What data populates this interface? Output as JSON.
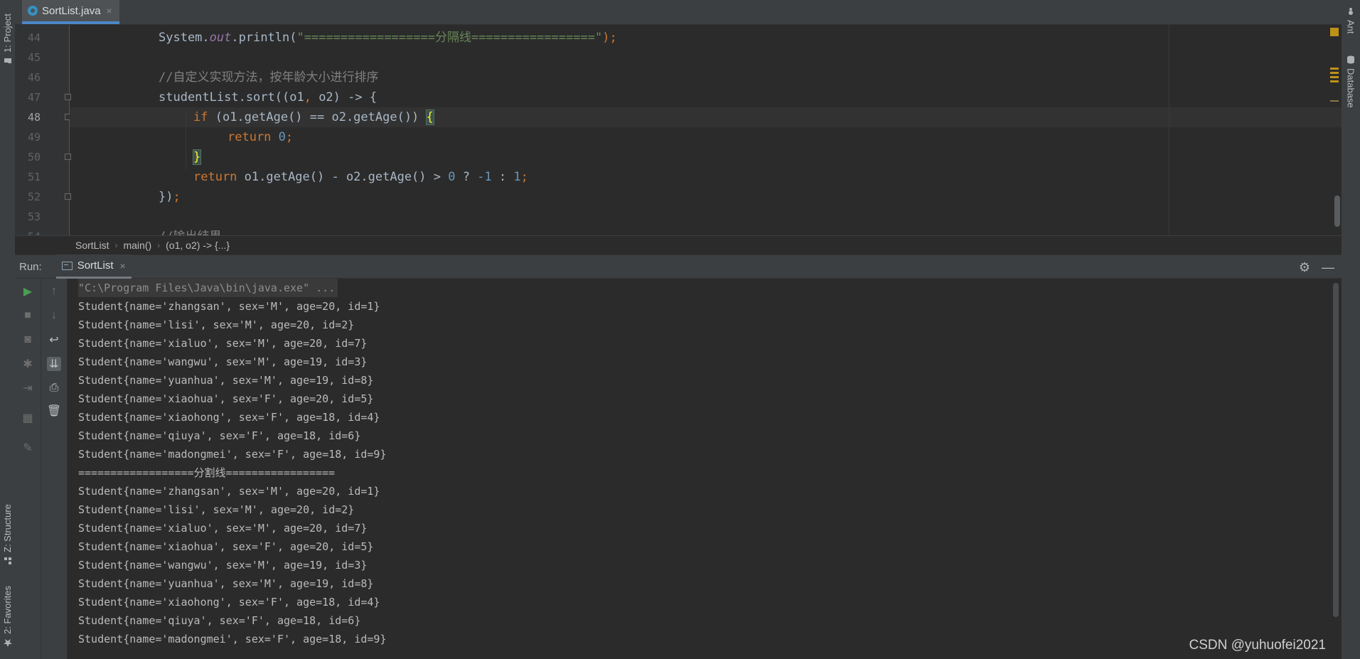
{
  "side_tabs": {
    "project": "1: Project",
    "structure": "Z: Structure",
    "favorites": "2: Favorites",
    "ant": "Ant",
    "database": "Database"
  },
  "editor": {
    "file_tab": "SortList.java",
    "tab_close": "×",
    "line_numbers": [
      "44",
      "45",
      "46",
      "47",
      "48",
      "49",
      "50",
      "51",
      "52",
      "53",
      "54"
    ],
    "lines": {
      "l44": {
        "a": "System.",
        "b": "out",
        "c": ".println(",
        "d": "\"==================分隔线=================\"",
        "e": ");"
      },
      "l46": {
        "a": "//自定义实现方法，按年龄大小进行排序"
      },
      "l47": {
        "a": "studentList.sort((o1",
        "b": ",",
        "c": " o2) -> {"
      },
      "l48": {
        "a": "if",
        "b": " (o1.getAge() == o2.getAge()) ",
        "c": "{"
      },
      "l49": {
        "a": "return",
        "b": " ",
        "c": "0",
        "d": ";"
      },
      "l50": {
        "a": "}"
      },
      "l51": {
        "a": "return",
        "b": " o1.getAge() - o2.getAge() > ",
        "c": "0",
        "d": " ? ",
        "e": "-1",
        "f": " : ",
        "g": "1",
        "h": ";"
      },
      "l52": {
        "a": "})",
        "b": ";"
      },
      "l54": {
        "a": "//输出结果"
      }
    }
  },
  "breadcrumb": [
    "SortList",
    "main()",
    "(o1, o2) -> {...}"
  ],
  "breadcrumb_sep": "›",
  "run": {
    "label": "Run:",
    "tab": "SortList",
    "tab_close": "×"
  },
  "console": {
    "lines": [
      "\"C:\\Program Files\\Java\\bin\\java.exe\" ...",
      "Student{name='zhangsan', sex='M', age=20, id=1}",
      "Student{name='lisi', sex='M', age=20, id=2}",
      "Student{name='xialuo', sex='M', age=20, id=7}",
      "Student{name='wangwu', sex='M', age=19, id=3}",
      "Student{name='yuanhua', sex='M', age=19, id=8}",
      "Student{name='xiaohua', sex='F', age=20, id=5}",
      "Student{name='xiaohong', sex='F', age=18, id=4}",
      "Student{name='qiuya', sex='F', age=18, id=6}",
      "Student{name='madongmei', sex='F', age=18, id=9}",
      "==================分割线=================",
      "Student{name='zhangsan', sex='M', age=20, id=1}",
      "Student{name='lisi', sex='M', age=20, id=2}",
      "Student{name='xialuo', sex='M', age=20, id=7}",
      "Student{name='xiaohua', sex='F', age=20, id=5}",
      "Student{name='wangwu', sex='M', age=19, id=3}",
      "Student{name='yuanhua', sex='M', age=19, id=8}",
      "Student{name='xiaohong', sex='F', age=18, id=4}",
      "Student{name='qiuya', sex='F', age=18, id=6}",
      "Student{name='madongmei', sex='F', age=18, id=9}"
    ]
  },
  "watermark": "CSDN @yuhuofei2021",
  "colors": {
    "background": "#2b2b2b",
    "panel": "#3c3f41",
    "keyword": "#cc7832",
    "number": "#6897bb",
    "string": "#6a8759",
    "comment": "#808080",
    "field": "#9876aa",
    "accent": "#4a88c7",
    "run_green": "#499c54"
  },
  "icons": [
    "java-class-icon",
    "lightbulb-icon",
    "fold-icon",
    "gear-icon",
    "minimize-icon",
    "run-icon",
    "stop-icon",
    "camera-icon",
    "debug-icon",
    "exit-icon",
    "layout-icon",
    "pin-icon",
    "up-arrow-icon",
    "down-arrow-icon",
    "soft-wrap-icon",
    "scroll-to-end-icon",
    "print-icon",
    "trash-icon",
    "folder-icon",
    "structure-icon",
    "star-icon",
    "ant-icon",
    "database-icon"
  ]
}
